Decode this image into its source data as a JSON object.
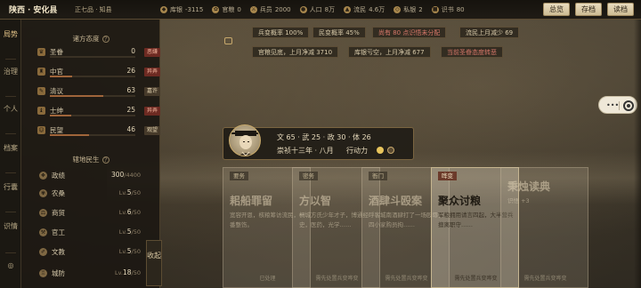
{
  "topbar": {
    "location": "陕西 · 安化县",
    "rank": "正七品 · 知县",
    "stats": [
      {
        "icon": "treasury-icon",
        "label": "库银",
        "value": "-3115"
      },
      {
        "icon": "grain-icon",
        "label": "官粮",
        "value": "0"
      },
      {
        "icon": "soldier-icon",
        "label": "兵员",
        "value": "2000"
      },
      {
        "icon": "population-icon",
        "label": "人口",
        "value": "8万"
      },
      {
        "icon": "refugee-icon",
        "label": "流民",
        "value": "4.6万"
      },
      {
        "icon": "private-silver-icon",
        "label": "私银",
        "value": "2"
      },
      {
        "icon": "knowledge-icon",
        "label": "识书",
        "value": "80"
      }
    ],
    "buttons": [
      "总览",
      "存档",
      "读档"
    ]
  },
  "rail": [
    "局势",
    "治理",
    "个人",
    "档案",
    "行囊",
    "识情"
  ],
  "attitudes": {
    "title": "诸方态度",
    "help": "?",
    "rows": [
      {
        "label": "圣眷",
        "value": "0",
        "tag": "恶嫌",
        "tag_style": "red",
        "pct": 0
      },
      {
        "label": "中官",
        "value": "26",
        "tag": "异弄",
        "tag_style": "red",
        "pct": 26
      },
      {
        "label": "清议",
        "value": "63",
        "tag": "嘉许",
        "tag_style": "dark",
        "pct": 63
      },
      {
        "label": "士绅",
        "value": "25",
        "tag": "异弄",
        "tag_style": "red",
        "pct": 25
      },
      {
        "label": "民望",
        "value": "46",
        "tag": "观望",
        "tag_style": "dark",
        "pct": 46
      }
    ]
  },
  "welfare": {
    "title": "辖地民生",
    "help": "?",
    "politics": {
      "label": "政绩",
      "value": "300",
      "max": "/4400"
    },
    "rows": [
      {
        "label": "农桑",
        "lv_prefix": "Lv.",
        "level": "5",
        "max": "/50"
      },
      {
        "label": "商贸",
        "lv_prefix": "Lv.",
        "level": "6",
        "max": "/50"
      },
      {
        "label": "官工",
        "lv_prefix": "Lv.",
        "level": "5",
        "max": "/50"
      },
      {
        "label": "文教",
        "lv_prefix": "Lv.",
        "level": "5",
        "max": "/50"
      },
      {
        "label": "城防",
        "lv_prefix": "Lv.",
        "level": "18",
        "max": "/50"
      }
    ]
  },
  "collapse_label": "收起",
  "chips": [
    {
      "text": "兵变概率 100%",
      "style": "normal"
    },
    {
      "text": "民变概率 45%",
      "style": "normal"
    },
    {
      "text": "尚有 80 点识悟未分配",
      "style": "red"
    },
    {
      "text": "流民上月减少 69",
      "style": "normal"
    },
    {
      "text": "官粮见底，上月净减 3710",
      "style": "normal"
    },
    {
      "text": "库银亏空，上月净减 677",
      "style": "normal"
    },
    {
      "text": "当前圣眷态度转恶",
      "style": "red"
    }
  ],
  "character": {
    "attrs": "文 65 · 武 25 · 政 30 · 体 26",
    "date": "崇祯十三年 · 八月",
    "ap_label": "行动力",
    "ap_colors": [
      "#e8c45c",
      "#5a4a32"
    ]
  },
  "cards": [
    {
      "category": "要务",
      "title": "耜船罪留",
      "desc": "宽容开恩，核粮筹访流民，一番整饬。",
      "foot": "已处理",
      "state": "dim"
    },
    {
      "category": "密务",
      "title": "方以智",
      "desc": "桐城方氏少年才子，博通经史，医药，光学……",
      "foot": "需先处置兵变哗变",
      "state": "dim"
    },
    {
      "category": "衙门",
      "title": "酒肆斗殴案",
      "desc": "呼客城南酒肆打了一场殴辱，四小家购员拘……",
      "foot": "需先处置兵变哗变",
      "state": "dim"
    },
    {
      "category": "哗变",
      "title": "聚众讨粮",
      "desc": "军粮拥用请言四起，大半营兵擅离职守……",
      "foot": "需先处置兵变哗变",
      "state": "active"
    },
    {
      "category": "",
      "title": "秉烛读典",
      "desc": "识悟 +3",
      "foot": "需先处置兵变哗变",
      "state": "dim"
    }
  ],
  "float_buttons": [
    "more-dots-icon",
    "record-icon"
  ]
}
